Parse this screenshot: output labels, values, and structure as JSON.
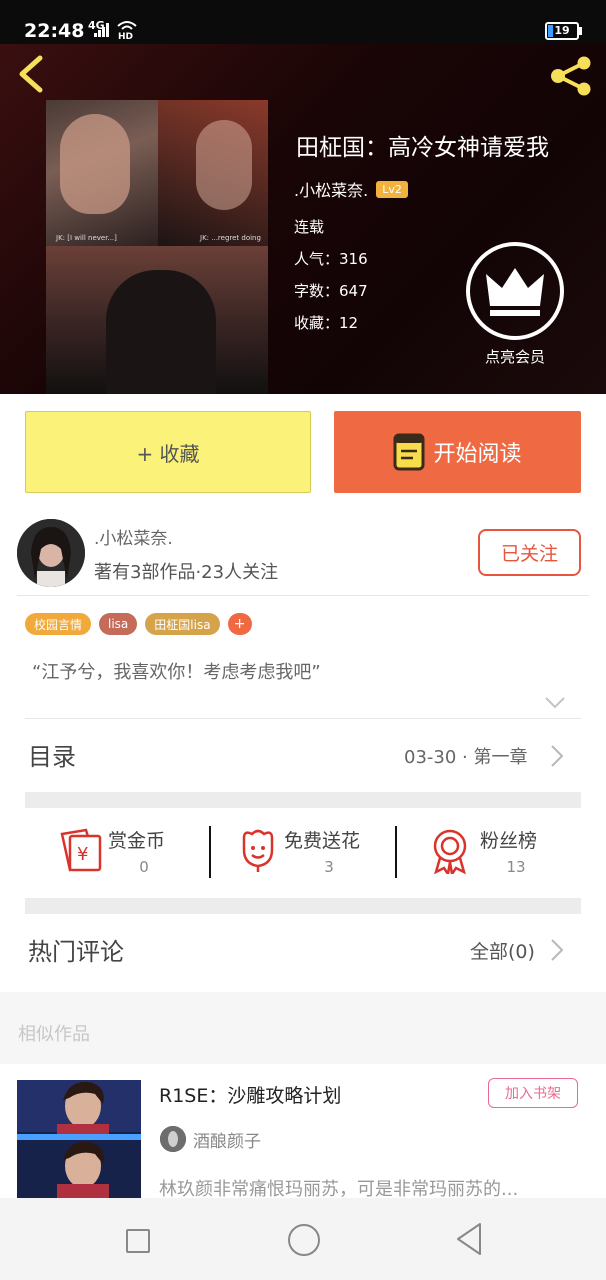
{
  "status_bar": {
    "time": "22:48",
    "network": "4G",
    "battery": "19",
    "battery_fraction": 0.19
  },
  "header": {
    "book_title": "田柾国：高冷女神请爱我",
    "author": ".小松菜奈.",
    "level": "Lv2",
    "status": "连载",
    "popularity": "人气：316",
    "word_count": "字数：647",
    "favorites": "收藏：12",
    "vip_label": "点亮会员",
    "cover_captions": [
      "JK: [I will never...]",
      "JK: ...regret doing"
    ]
  },
  "actions": {
    "collect": "+ 收藏",
    "read": "开始阅读"
  },
  "author_info": {
    "name": ".小松菜奈.",
    "stats": "著有3部作品·23人关注",
    "follow": "已关注"
  },
  "tags": [
    {
      "label": "校园言情",
      "color": "#f0a93a"
    },
    {
      "label": "lisa",
      "color": "#c56b5a"
    },
    {
      "label": "田柾国lisa",
      "color": "#d5a34a"
    }
  ],
  "tag_add": "+",
  "intro": "“江予兮，我喜欢你！考虑考虑我吧”",
  "catalog": {
    "title": "目录",
    "latest": "03-30 · 第一章"
  },
  "rewards": [
    {
      "label": "赏金币",
      "count": "0"
    },
    {
      "label": "免费送花",
      "count": "3"
    },
    {
      "label": "粉丝榜",
      "count": "13"
    }
  ],
  "comments": {
    "title": "热门评论",
    "all": "全部(0)"
  },
  "similar": {
    "section_label": "相似作品",
    "title": "R1SE：沙雕攻略计划",
    "shelf_button": "加入书架",
    "author": "酒酿颜子",
    "description": "林玖颜非常痛恨玛丽苏，可是非常玛丽苏的..."
  },
  "colors": {
    "accent": "#ef6a43",
    "collect_bg": "#fbf27a",
    "header_bg": "#1a0506",
    "icon_red": "#d9342b"
  }
}
